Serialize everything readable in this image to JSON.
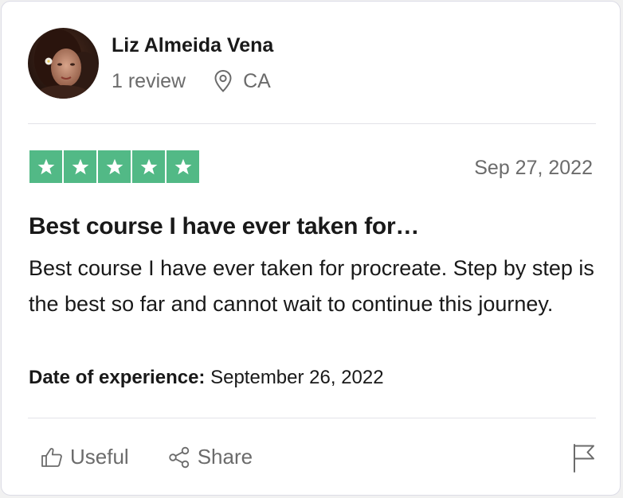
{
  "reviewer": {
    "name": "Liz Almeida Vena",
    "review_count": "1 review",
    "location": "CA"
  },
  "rating": {
    "stars": 5,
    "max_stars": 5,
    "star_color": "#00b67a",
    "star_bg": "#52b986"
  },
  "review": {
    "date": "Sep 27, 2022",
    "title": "Best course I have ever taken for…",
    "body": "Best course I have ever taken for procreate. Step by step is the best so far and cannot wait to continue this journey.",
    "experience_label": "Date of experience:",
    "experience_date": "September 26, 2022"
  },
  "actions": {
    "useful_label": "Useful",
    "share_label": "Share"
  },
  "icons": {
    "location": "location-pin-icon",
    "useful": "thumbs-up-icon",
    "share": "share-icon",
    "report": "flag-icon"
  }
}
